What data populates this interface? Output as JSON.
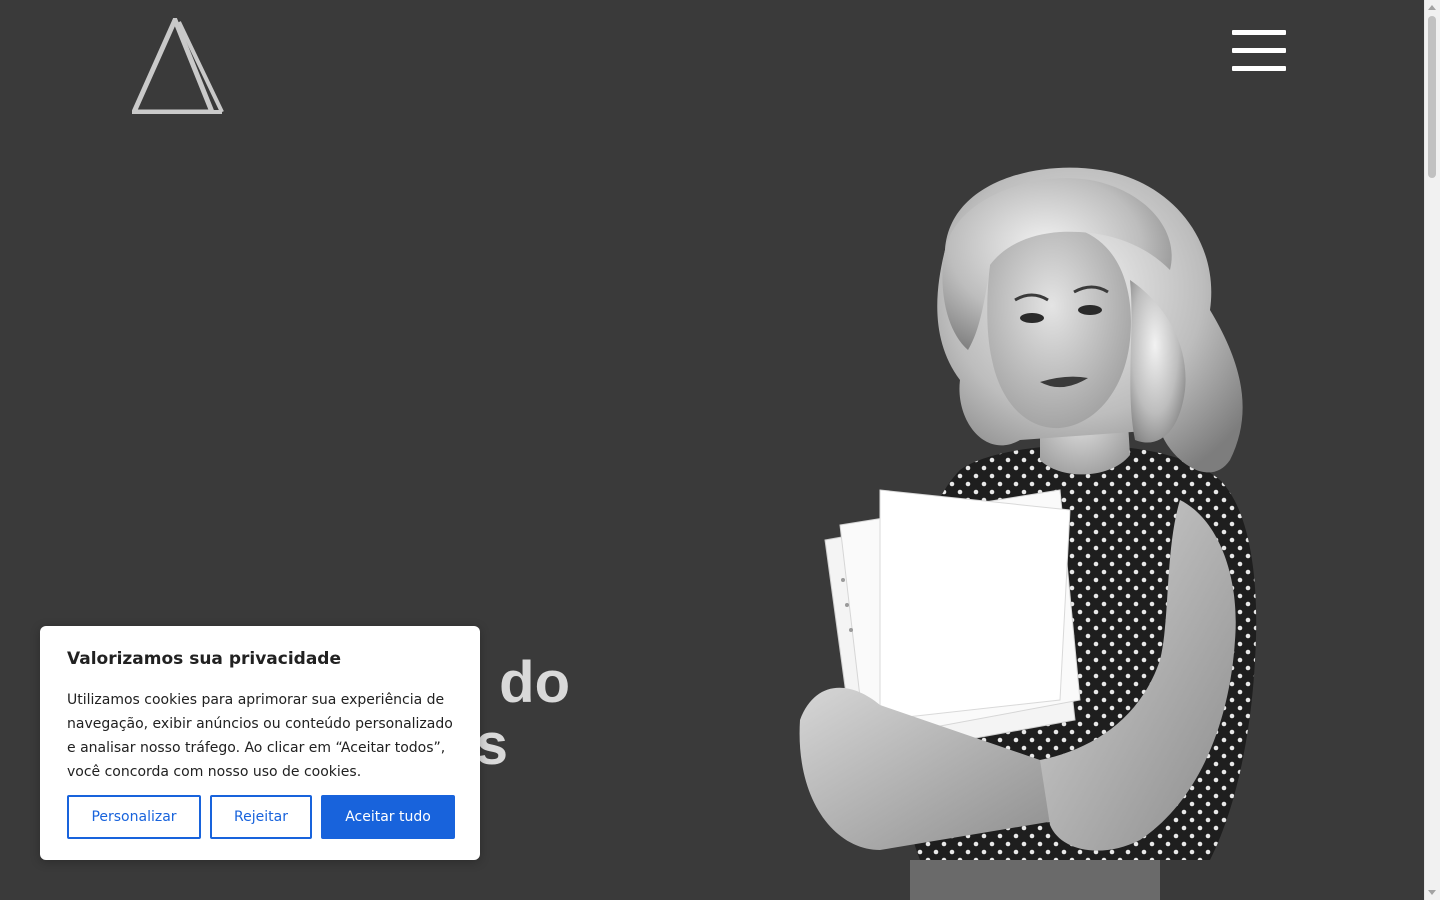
{
  "header": {
    "logo_icon": "delta-triangle-logo",
    "menu_icon": "hamburger-menu-icon"
  },
  "hero": {
    "heading_line1": "do",
    "heading_line2": "s",
    "figure_icon": "woman-holding-papers-illustration"
  },
  "cookie_banner": {
    "title": "Valorizamos sua privacidade",
    "text": "Utilizamos cookies para aprimorar sua experiência de navegação, exibir anúncios ou conteúdo personalizado e analisar nosso tráfego. Ao clicar em “Aceitar todos”, você concorda com nosso uso de cookies.",
    "customize_label": "Personalizar",
    "reject_label": "Rejeitar",
    "accept_label": "Aceitar tudo"
  },
  "colors": {
    "background": "#3a3a3a",
    "accent": "#1863dc",
    "modal_background": "#ffffff",
    "text_dark": "#212121"
  }
}
